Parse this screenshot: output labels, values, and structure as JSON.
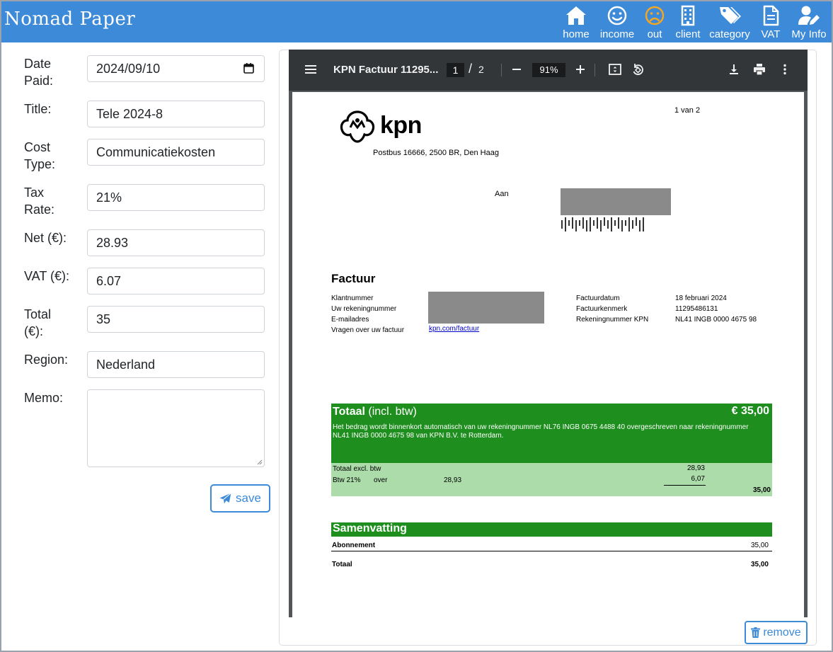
{
  "app": {
    "title": "Nomad Paper",
    "accent": "#3c8ad8",
    "nav": [
      {
        "label": "home",
        "icon": "home-icon"
      },
      {
        "label": "income",
        "icon": "smile-icon"
      },
      {
        "label": "out",
        "icon": "frown-icon",
        "color": "#f5a623"
      },
      {
        "label": "client",
        "icon": "building-icon"
      },
      {
        "label": "category",
        "icon": "tags-icon"
      },
      {
        "label": "VAT",
        "icon": "document-icon"
      },
      {
        "label": "My Info",
        "icon": "user-edit-icon"
      }
    ]
  },
  "form": {
    "date_paid_label": "Date Paid:",
    "date_paid_value": "2024/09/10",
    "title_label": "Title:",
    "title_value": "Tele 2024-8",
    "cost_type_label": "Cost Type:",
    "cost_type_value": "Communicatiekosten",
    "tax_rate_label": "Tax Rate:",
    "tax_rate_value": "21%",
    "net_label": "Net (€):",
    "net_value": "28.93",
    "vat_label": "VAT (€):",
    "vat_value": "6.07",
    "total_label": "Total (€):",
    "total_value": "35",
    "region_label": "Region:",
    "region_value": "Nederland",
    "memo_label": "Memo:",
    "memo_value": "",
    "save_label": "save"
  },
  "viewer": {
    "file_name": "KPN Factuur 11295...",
    "page_current": "1",
    "page_total": "2",
    "zoom": "91%",
    "remove_label": "remove"
  },
  "invoice": {
    "page_indicator": "1 van 2",
    "logo_text": "kpn",
    "address": "Postbus 16666, 2500 BR, Den Haag",
    "aan_label": "Aan",
    "heading": "Factuur",
    "left_labels": [
      "Klantnummer",
      "Uw rekeningnummer",
      "E-mailadres",
      "Vragen over uw factuur"
    ],
    "link": "kpn.com/factuur",
    "right_labels": [
      "Factuurdatum",
      "Factuurkenmerk",
      "Rekeningnummer KPN"
    ],
    "right_values": [
      "18 februari 2024",
      "11295486131",
      "NL41 INGB 0000 4675 98"
    ],
    "total_title": "Totaal",
    "total_title_suffix": "(incl. btw)",
    "total_amount": "€  35,00",
    "total_note": "Het bedrag wordt binnenkort automatisch van uw rekeningnummer NL76 INGB 0675 4488 40 overgeschreven naar rekeningnummer NL41 INGB 0000 4675 98 van KPN B.V. te Rotterdam.",
    "excl_label": "Totaal excl. btw",
    "excl_value": "28,93",
    "btw_label": "Btw 21%",
    "btw_over": "over",
    "btw_base": "28,93",
    "btw_value": "6,07",
    "sum_value": "35,00",
    "summary_title": "Samenvatting",
    "summary_row_label": "Abonnement",
    "summary_row_value": "35,00",
    "summary_total_label": "Totaal",
    "summary_total_value": "35,00",
    "green_dark": "#1e8f1e",
    "green_light": "#acdcaa"
  }
}
